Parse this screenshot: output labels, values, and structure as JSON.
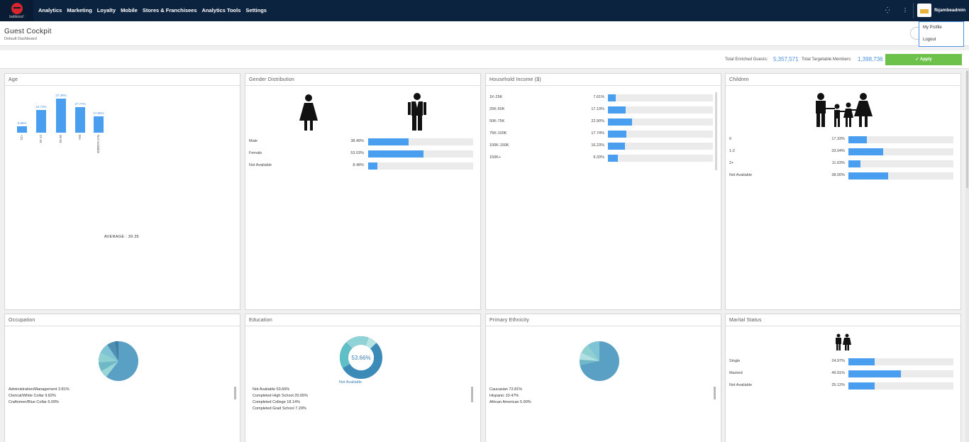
{
  "nav": {
    "brand": "bahbooz!",
    "items": [
      "Analytics",
      "Marketing",
      "Loyalty",
      "Mobile",
      "Stores & Franchisees",
      "Analytics Tools",
      "Settings"
    ],
    "username": "fbjambeadmin"
  },
  "dropdown": {
    "items": [
      "My Profile",
      "Logout"
    ]
  },
  "header": {
    "title": "Guest Cockpit",
    "subtitle": "Default Dashboard"
  },
  "totals": {
    "enriched_label": "Total Enriched Guests:",
    "enriched_value": "5,357,571",
    "targetable_label": "Total Targetable Members:",
    "targetable_value": "1,398,736",
    "apply_label": "Apply"
  },
  "age": {
    "title": "Age",
    "bars": [
      {
        "category": "<21",
        "value": 6.86,
        "label": "6.86%"
      },
      {
        "category": "21-34",
        "value": 24.73,
        "label": "24.73%"
      },
      {
        "category": "35-54",
        "value": 37.39,
        "label": "37.39%"
      },
      {
        "category": "55+",
        "value": 27.77,
        "label": "27.77%"
      },
      {
        "category": "Not Available",
        "value": 17.86,
        "label": "17.86%"
      }
    ],
    "average": "AVERAGE : 39.35"
  },
  "gender": {
    "title": "Gender Distribution",
    "rows": [
      {
        "label": "Male",
        "pct": "38.49%",
        "value": 38.49
      },
      {
        "label": "Female",
        "pct": "53.03%",
        "value": 53.03
      },
      {
        "label": "Not Available",
        "pct": "8.48%",
        "value": 8.48
      }
    ]
  },
  "income": {
    "title": "Household Income ($)",
    "rows": [
      {
        "label": "1K-25K",
        "pct": "7.61%",
        "value": 7.61
      },
      {
        "label": "25K-50K",
        "pct": "17.19%",
        "value": 17.19
      },
      {
        "label": "50K-75K",
        "pct": "22.90%",
        "value": 22.9
      },
      {
        "label": "75K-100K",
        "pct": "17.74%",
        "value": 17.74
      },
      {
        "label": "100K-150K",
        "pct": "16.23%",
        "value": 16.23
      },
      {
        "label": "150K+",
        "pct": "9.33%",
        "value": 9.33
      }
    ]
  },
  "children": {
    "title": "Children",
    "rows": [
      {
        "label": "0",
        "pct": "17.33%",
        "value": 17.33
      },
      {
        "label": "1-2",
        "pct": "33.04%",
        "value": 33.04
      },
      {
        "label": "2+",
        "pct": "11.63%",
        "value": 11.63
      },
      {
        "label": "Not Available",
        "pct": "38.00%",
        "value": 38.0
      }
    ]
  },
  "occupation": {
    "title": "Occupation",
    "legend": [
      "Administration/Management 3.81%",
      "Clerical/White Collar 9.82%",
      "Craftsmen/Blue Collar 6.09%"
    ]
  },
  "education": {
    "title": "Education",
    "center": "53.66%",
    "center_label": "Not Available",
    "legend": [
      "Not Available 53.66%",
      "Completed High School 20.65%",
      "Completed College 18.14%",
      "Completed Grad School 7.29%"
    ]
  },
  "ethnicity": {
    "title": "Primary Ethnicity",
    "legend": [
      "Caucasian 72.81%",
      "Hispanic 10.47%",
      "African American 5.90%"
    ]
  },
  "marital": {
    "title": "Marital Status",
    "rows": [
      {
        "label": "Single",
        "pct": "24.97%",
        "value": 24.97
      },
      {
        "label": "Married",
        "pct": "49.91%",
        "value": 49.91
      },
      {
        "label": "Not Available",
        "pct": "25.12%",
        "value": 25.12
      }
    ]
  },
  "colors": {
    "nav": "#0c2340",
    "bar": "#4a9ef0",
    "apply": "#6cc24a",
    "accent": "#4a90e2"
  }
}
